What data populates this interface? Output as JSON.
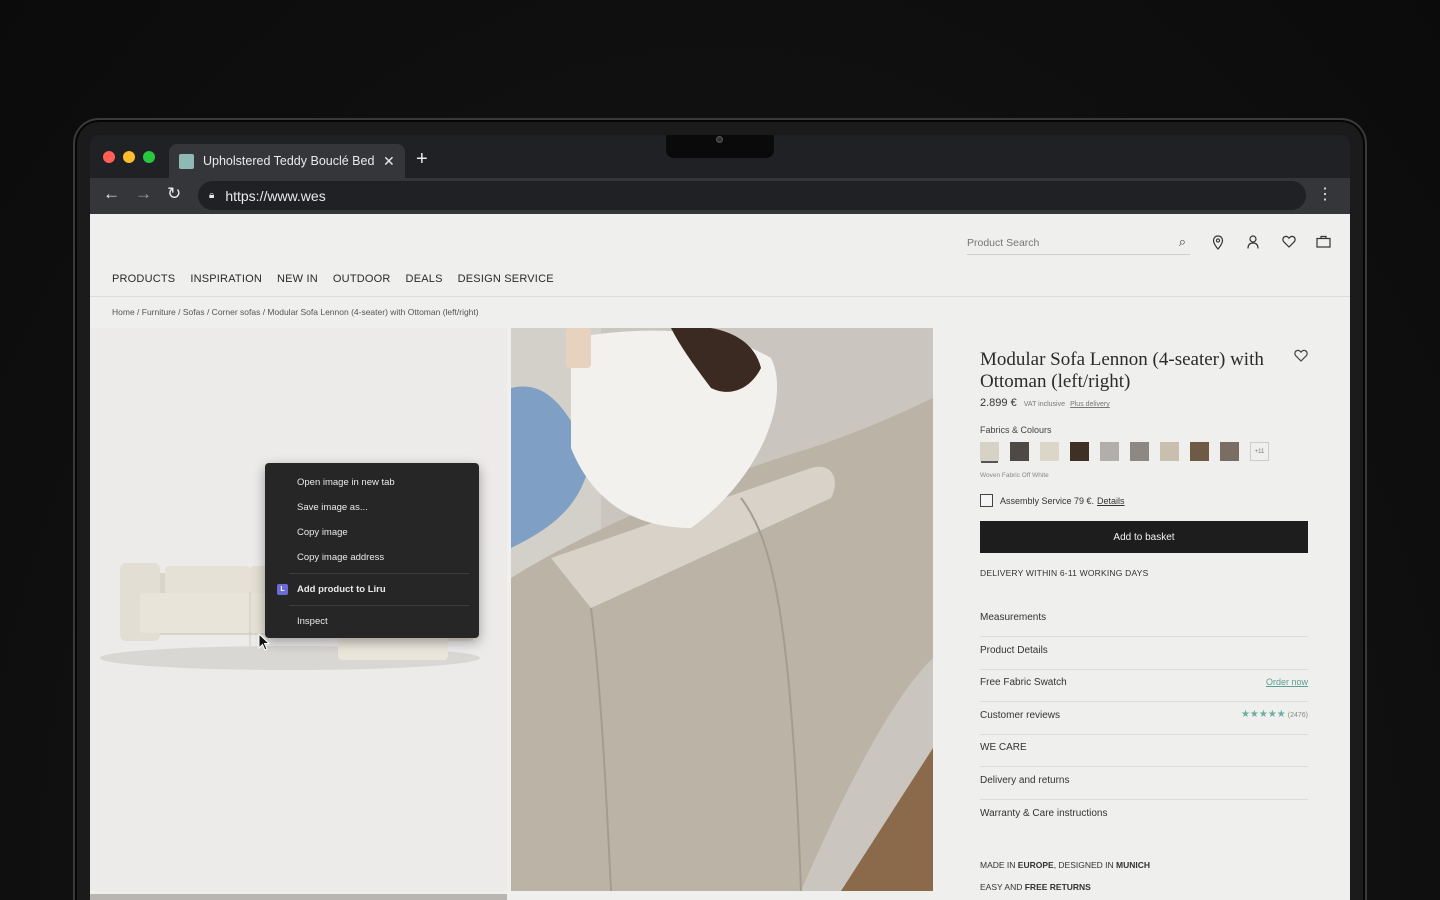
{
  "browser": {
    "tab_title": "Upholstered Teddy Bouclé Bed",
    "url": "https://www.wes"
  },
  "header": {
    "search_placeholder": "Product Search",
    "nav": [
      "PRODUCTS",
      "INSPIRATION",
      "NEW IN",
      "OUTDOOR",
      "DEALS",
      "DESIGN SERVICE"
    ]
  },
  "breadcrumb": "Home / Furniture / Sofas / Corner sofas / Modular Sofa Lennon (4-seater) with Ottoman (left/right)",
  "context_menu": {
    "items": [
      "Open image in new tab",
      "Save image as...",
      "Copy image",
      "Copy image address"
    ],
    "extension_item": "Add product to Liru",
    "inspect": "Inspect"
  },
  "product": {
    "title": "Modular Sofa Lennon (4-seater) with Ottoman (left/right)",
    "price": "2.899 €",
    "vat": "VAT inclusive",
    "vat_link": "Plus delivery",
    "fabrics_label": "Fabrics & Colours",
    "swatch_colors": [
      "#d7d2c6",
      "#4e4944",
      "#dcd6c9",
      "#3f3026",
      "#b2aeab",
      "#8e8882",
      "#c8bfae",
      "#6f5a46",
      "#7a6e64"
    ],
    "more_swatches": "+11",
    "selected_fabric": "Woven Fabric Off White",
    "assembly_label": "Assembly Service 79 €.",
    "assembly_link": "Details",
    "basket_button": "Add to basket",
    "delivery_text": "DELIVERY WITHIN 6-11 WORKING DAYS",
    "accordion": {
      "measurements": "Measurements",
      "product_details": "Product Details",
      "free_swatch": "Free Fabric Swatch",
      "order_now": "Order now",
      "customer_reviews": "Customer reviews",
      "stars": "★★★★★",
      "review_count": "(2476)",
      "we_care": "WE CARE",
      "delivery_returns": "Delivery and returns",
      "warranty": "Warranty & Care instructions"
    },
    "made_in": {
      "p1": "MADE IN ",
      "b1": "EUROPE",
      "p2": ", DESIGNED IN ",
      "b2": "MUNICH"
    },
    "easy_returns": {
      "p1": "EASY AND ",
      "b1": "FREE RETURNS"
    }
  }
}
